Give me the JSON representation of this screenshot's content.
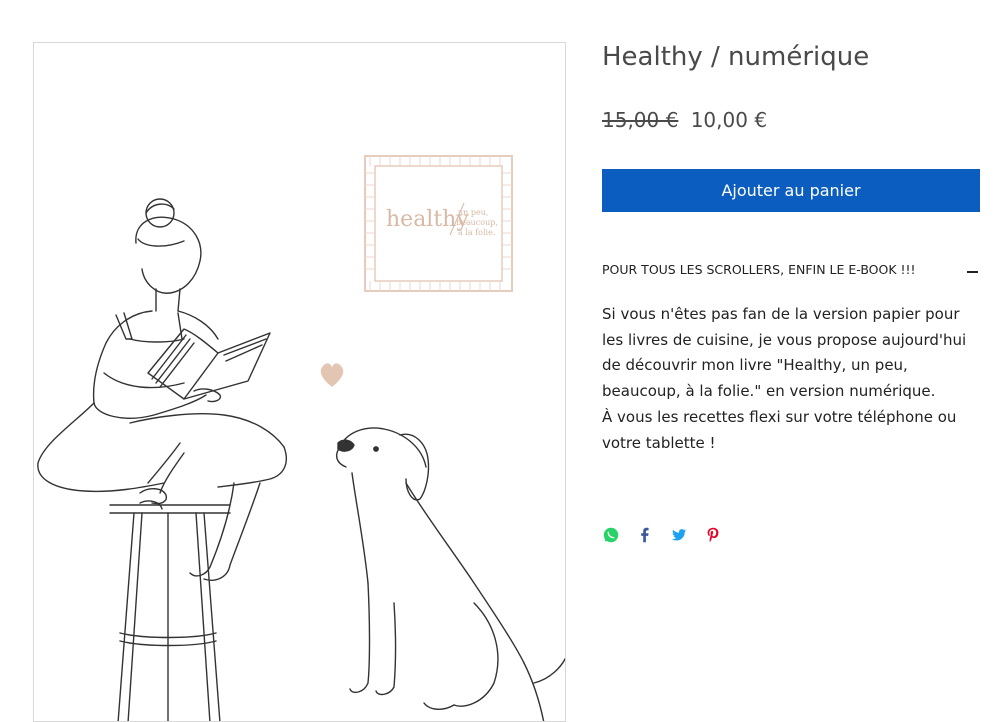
{
  "product": {
    "image_logo_main": "healthy",
    "image_logo_sub": [
      "un peu,",
      "beaucoup,",
      "à la folie."
    ],
    "title": "Healthy / numérique",
    "price_old": "15,00 €",
    "price_new": "10,00 €",
    "add_to_cart_label": "Ajouter au panier",
    "accordion_title": "POUR TOUS LES SCROLLERS, ENFIN LE E-BOOK !!!",
    "description": [
      "Si vous n'êtes pas fan de la version papier pour les livres de cuisine, je vous propose aujourd'hui de découvrir mon livre \"Healthy, un peu, beaucoup, à la folie.\" en version numérique.",
      "À vous les recettes flexi sur votre téléphone ou votre tablette !"
    ]
  },
  "share": [
    {
      "name": "whatsapp-icon",
      "color": "#25d366"
    },
    {
      "name": "facebook-icon",
      "color": "#3b5998"
    },
    {
      "name": "twitter-icon",
      "color": "#1da1f2"
    },
    {
      "name": "pinterest-icon",
      "color": "#e60023"
    }
  ],
  "colors": {
    "accent": "#0b5ebf",
    "logo": "#d8b9a4"
  }
}
